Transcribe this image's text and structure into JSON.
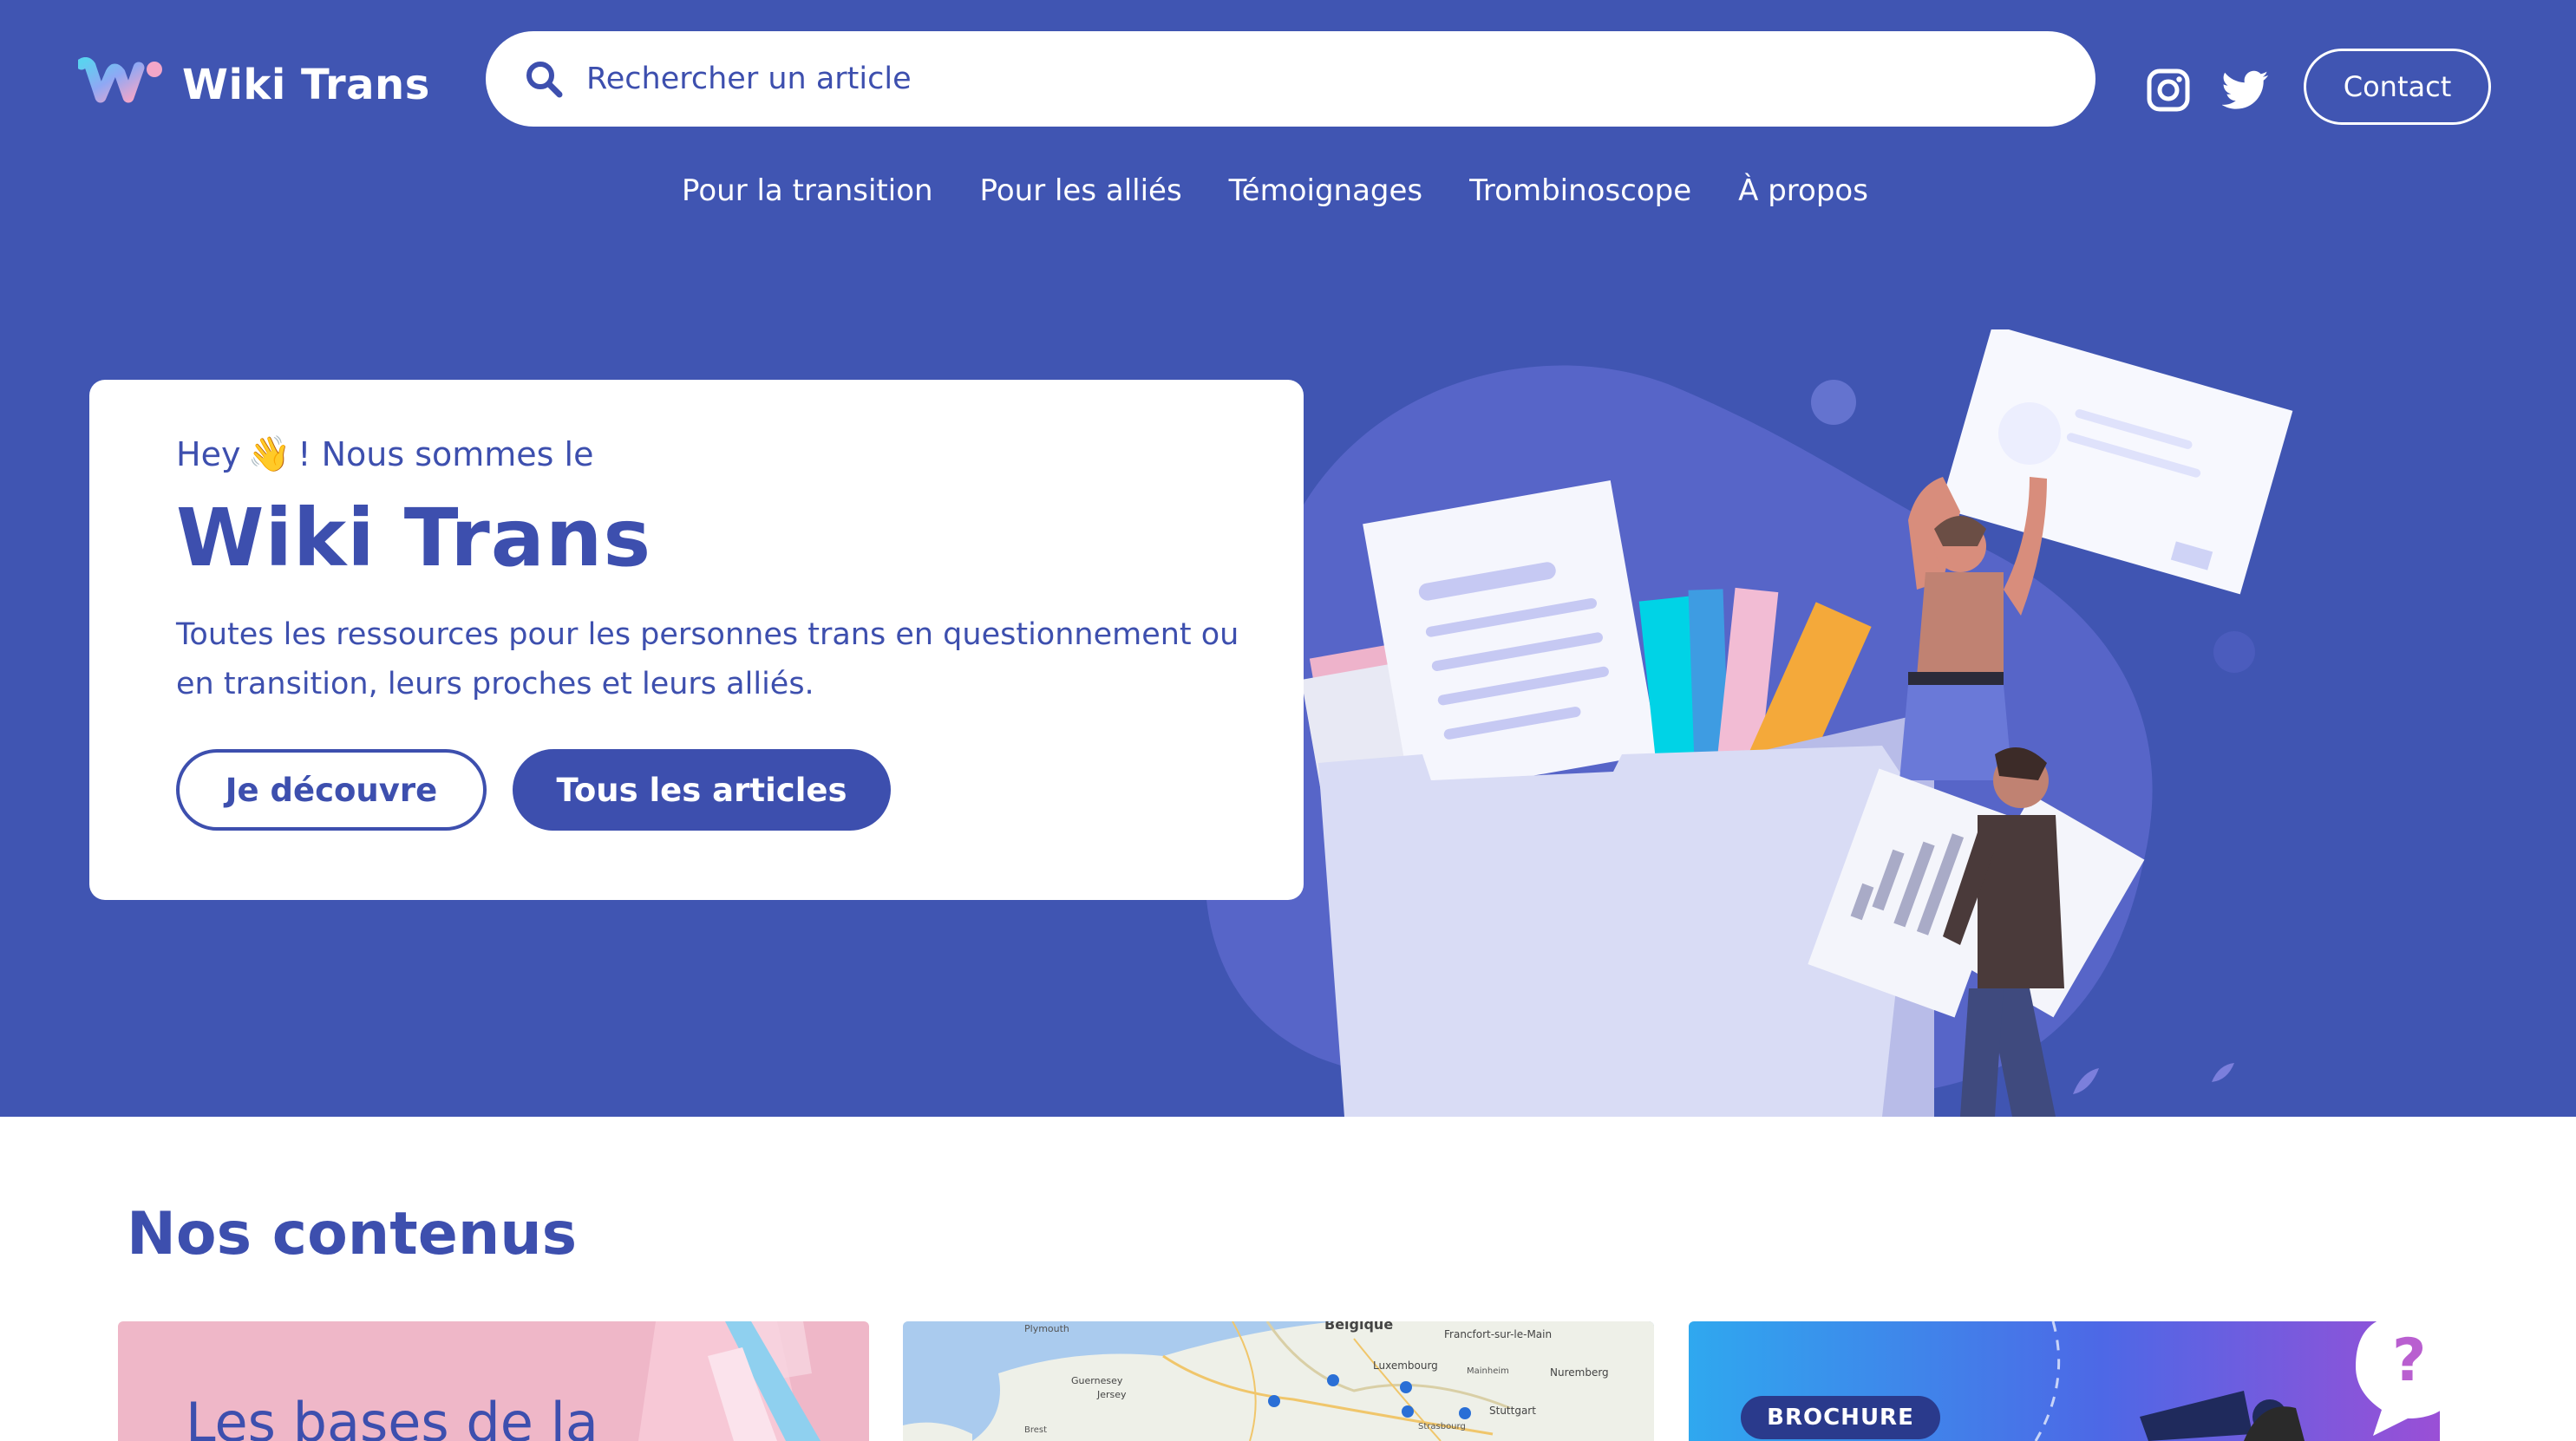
{
  "header": {
    "brand": "Wiki Trans",
    "search_placeholder": "Rechercher un article",
    "contact_label": "Contact",
    "social": [
      "instagram-icon",
      "twitter-icon"
    ]
  },
  "nav": {
    "items": [
      {
        "label": "Pour la transition"
      },
      {
        "label": "Pour les alliés"
      },
      {
        "label": "Témoignages"
      },
      {
        "label": "Trombinoscope"
      },
      {
        "label": "À propos"
      }
    ]
  },
  "hero": {
    "hey_prefix": "Hey",
    "wave": "👋",
    "hey_suffix": "! Nous sommes le",
    "title": "Wiki Trans",
    "description": "Toutes les ressources pour les personnes trans en questionnement ou en transition, leurs proches et leurs alliés.",
    "discover_label": "Je découvre",
    "all_articles_label": "Tous les articles"
  },
  "contents": {
    "title": "Nos contenus",
    "cards": [
      {
        "title": "Les bases de la"
      },
      {
        "map_labels": [
          "Plymouth",
          "Belgique",
          "Francfort-sur-le-Main",
          "Luxembourg",
          "Mainheim",
          "Nuremberg",
          "Guernesey",
          "Jersey",
          "Stuttgart",
          "Strasbourg",
          "Brest"
        ]
      },
      {
        "badge": "BROCHURE"
      }
    ],
    "help_mark": "?"
  },
  "colors": {
    "primary": "#4055b2",
    "primary_dark": "#3d4fae",
    "white": "#ffffff"
  }
}
